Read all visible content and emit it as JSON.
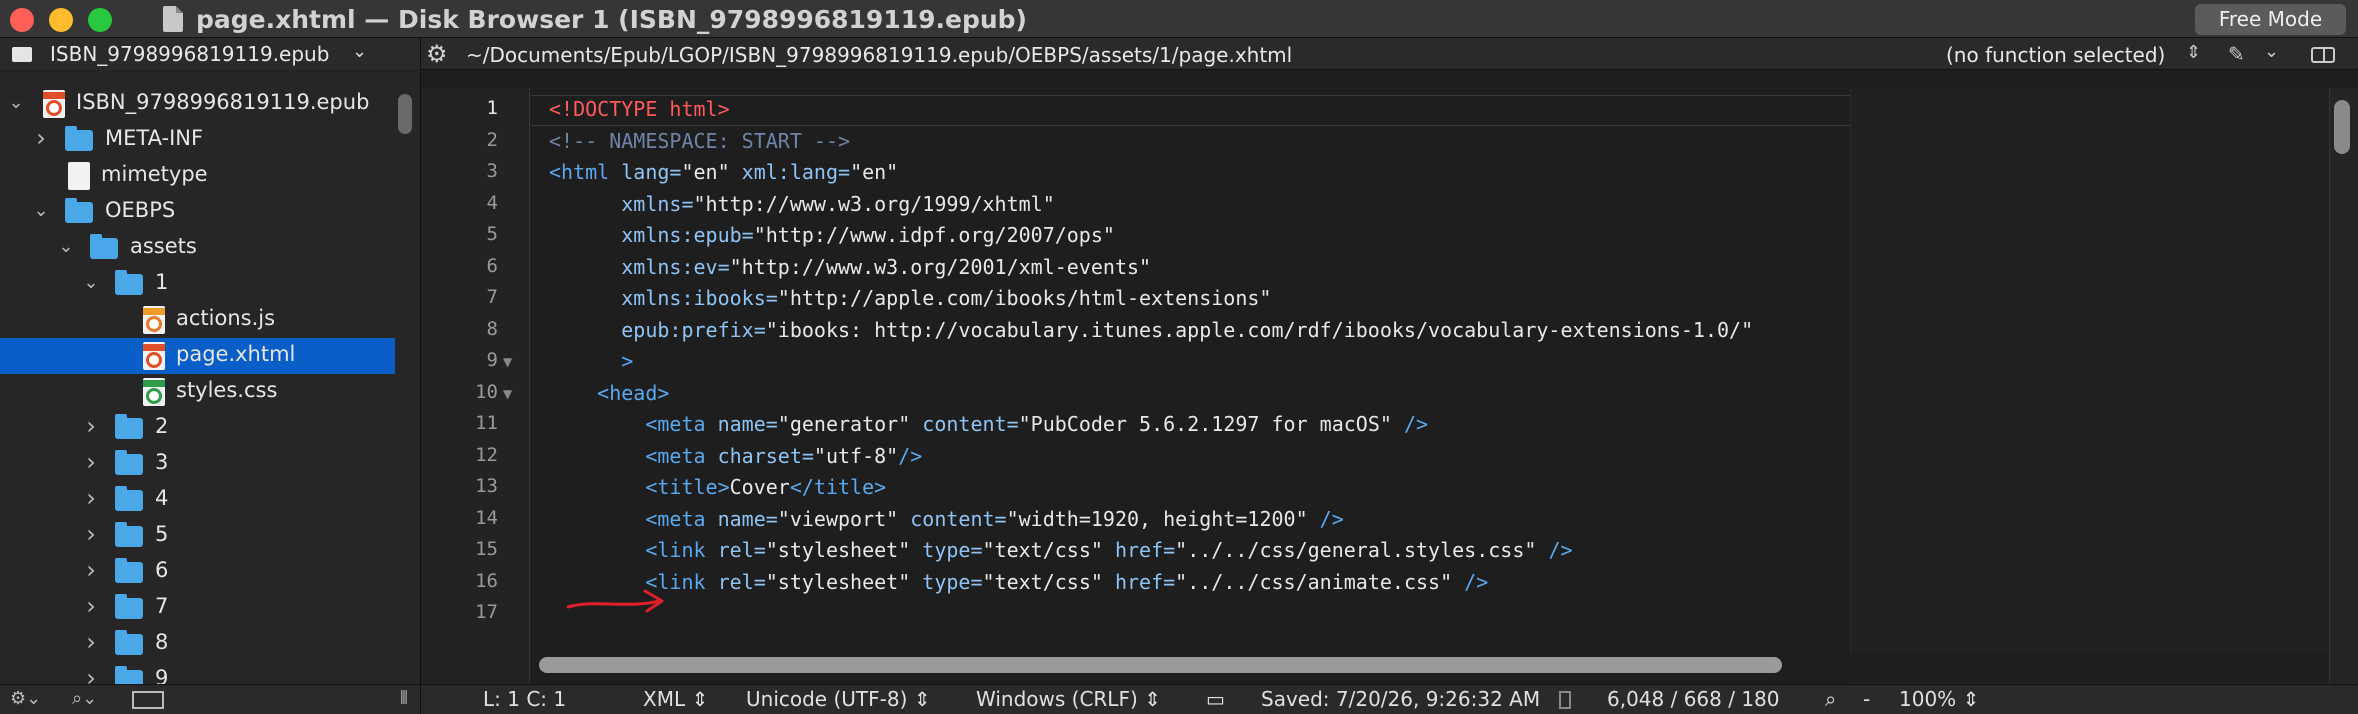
{
  "window": {
    "title": "page.xhtml — Disk Browser 1 (ISBN_9798996819119.epub)",
    "mode_button": "Free Mode"
  },
  "sidebar": {
    "header": "ISBN_9798996819119.epub",
    "tree": [
      {
        "label": "ISBN_9798996819119.epub",
        "indent": 0,
        "kind": "epub",
        "expanded": true
      },
      {
        "label": "META-INF",
        "indent": 1,
        "kind": "folder",
        "expanded": false
      },
      {
        "label": "mimetype",
        "indent": 1,
        "kind": "file"
      },
      {
        "label": "OEBPS",
        "indent": 1,
        "kind": "folder",
        "expanded": true
      },
      {
        "label": "assets",
        "indent": 2,
        "kind": "folder",
        "expanded": true
      },
      {
        "label": "1",
        "indent": 3,
        "kind": "folder",
        "expanded": true
      },
      {
        "label": "actions.js",
        "indent": 4,
        "kind": "js"
      },
      {
        "label": "page.xhtml",
        "indent": 4,
        "kind": "xhtml",
        "selected": true
      },
      {
        "label": "styles.css",
        "indent": 4,
        "kind": "css"
      },
      {
        "label": "2",
        "indent": 3,
        "kind": "folder",
        "expanded": false
      },
      {
        "label": "3",
        "indent": 3,
        "kind": "folder",
        "expanded": false
      },
      {
        "label": "4",
        "indent": 3,
        "kind": "folder",
        "expanded": false
      },
      {
        "label": "5",
        "indent": 3,
        "kind": "folder",
        "expanded": false
      },
      {
        "label": "6",
        "indent": 3,
        "kind": "folder",
        "expanded": false
      },
      {
        "label": "7",
        "indent": 3,
        "kind": "folder",
        "expanded": false
      },
      {
        "label": "8",
        "indent": 3,
        "kind": "folder",
        "expanded": false
      },
      {
        "label": "9",
        "indent": 3,
        "kind": "folder",
        "expanded": false
      }
    ]
  },
  "navbar": {
    "path": "~/Documents/Epub/LGOP/ISBN_9798996819119.epub/OEBPS/assets/1/page.xhtml",
    "function_selector": "(no function selected)"
  },
  "editor": {
    "current_line": 1,
    "line_numbers": [
      "1",
      "2",
      "3",
      "4",
      "5",
      "6",
      "7",
      "8",
      "9",
      "10",
      "11",
      "12",
      "13",
      "14",
      "15",
      "16",
      "17"
    ],
    "folds": [
      9,
      10
    ],
    "lines": [
      [
        [
          "dt",
          "<!DOCTYPE html>"
        ]
      ],
      [
        [
          "cm",
          "<!-- NAMESPACE: START -->"
        ]
      ],
      [
        [
          "tg",
          "<html "
        ],
        [
          "at",
          "lang="
        ],
        [
          "st",
          "\"en\""
        ],
        [
          "at",
          " xml:lang="
        ],
        [
          "st",
          "\"en\""
        ]
      ],
      [
        [
          "at",
          "      xmlns="
        ],
        [
          "st",
          "\"http://www.w3.org/1999/xhtml\""
        ]
      ],
      [
        [
          "at",
          "      xmlns:epub="
        ],
        [
          "st",
          "\"http://www.idpf.org/2007/ops\""
        ]
      ],
      [
        [
          "at",
          "      xmlns:ev="
        ],
        [
          "st",
          "\"http://www.w3.org/2001/xml-events\""
        ]
      ],
      [
        [
          "at",
          "      xmlns:ibooks="
        ],
        [
          "st",
          "\"http://apple.com/ibooks/html-extensions\""
        ]
      ],
      [
        [
          "at",
          "      epub:prefix="
        ],
        [
          "st",
          "\"ibooks: http://vocabulary.itunes.apple.com/rdf/ibooks/vocabulary-extensions-1.0/\""
        ]
      ],
      [
        [
          "tg",
          "      >"
        ]
      ],
      [
        [
          "tg",
          "    <head>"
        ]
      ],
      [
        [
          "tg",
          "        <meta "
        ],
        [
          "at",
          "name="
        ],
        [
          "st",
          "\"generator\""
        ],
        [
          "at",
          " content="
        ],
        [
          "st",
          "\"PubCoder 5.6.2.1297 for macOS\""
        ],
        [
          "tg",
          " />"
        ]
      ],
      [
        [
          "tg",
          "        <meta "
        ],
        [
          "at",
          "charset="
        ],
        [
          "st",
          "\"utf-8\""
        ],
        [
          "tg",
          "/>"
        ]
      ],
      [
        [
          "tg",
          "        <title>"
        ],
        [
          "tx",
          "Cover"
        ],
        [
          "tg",
          "</title>"
        ]
      ],
      [
        [
          "tg",
          "        <meta "
        ],
        [
          "at",
          "name="
        ],
        [
          "st",
          "\"viewport\""
        ],
        [
          "at",
          " content="
        ],
        [
          "st",
          "\"width=1920, height=1200\""
        ],
        [
          "tg",
          " />"
        ]
      ],
      [
        [
          "tg",
          "        <link "
        ],
        [
          "at",
          "rel="
        ],
        [
          "st",
          "\"stylesheet\""
        ],
        [
          "at",
          " type="
        ],
        [
          "st",
          "\"text/css\""
        ],
        [
          "at",
          " href="
        ],
        [
          "st",
          "\"../../css/general.styles.css\""
        ],
        [
          "tg",
          " />"
        ]
      ],
      [
        [
          "tg",
          "        <link "
        ],
        [
          "at",
          "rel="
        ],
        [
          "st",
          "\"stylesheet\""
        ],
        [
          "at",
          " type="
        ],
        [
          "st",
          "\"text/css\""
        ],
        [
          "at",
          " href="
        ],
        [
          "st",
          "\"../../css/animate.css\""
        ],
        [
          "tg",
          " />"
        ]
      ],
      []
    ]
  },
  "status": {
    "position": "L: 1 C: 1",
    "syntax": "XML",
    "encoding": "Unicode (UTF-8)",
    "line_endings": "Windows (CRLF)",
    "saved": "Saved: 7/20/26, 9:26:32 AM",
    "counts": "6,048 / 668 / 180",
    "zoom_minus": "-",
    "zoom": "100%"
  },
  "colors": {
    "selection": "#0a5ec8",
    "folder": "#4aa8e8",
    "annotation_arrow": "#e0202a"
  }
}
